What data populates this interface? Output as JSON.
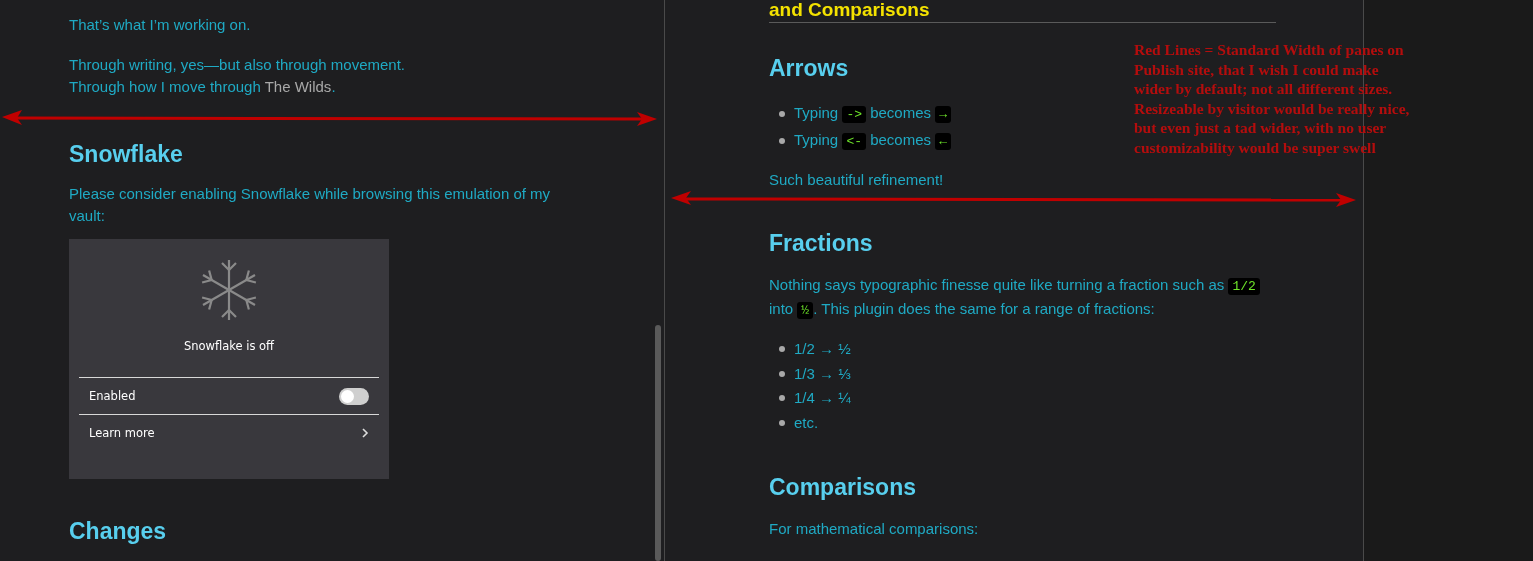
{
  "left_pane": {
    "paragraphs": [
      [
        {
          "kind": "text",
          "text": "That’s what I’m working on."
        }
      ],
      [
        {
          "kind": "text",
          "text": "Through writing, yes—but also through movement."
        },
        {
          "kind": "break"
        },
        {
          "kind": "text",
          "text": "Through how I move through "
        },
        {
          "kind": "link",
          "text": "The Wilds"
        },
        {
          "kind": "text",
          "text": "."
        }
      ]
    ],
    "section": {
      "heading": "Snowflake",
      "paragraph": [
        {
          "kind": "text",
          "text": "Please consider enabling Snowflake while browsing this emulation of my vault:"
        }
      ],
      "card": {
        "status": "Snowflake is off",
        "rows": [
          {
            "kind": "toggle",
            "label": "Enabled",
            "on": false
          },
          {
            "kind": "link",
            "label": "Learn more"
          }
        ]
      }
    },
    "next_heading": "Changes"
  },
  "right_pane": {
    "top_heading": "and Comparisons",
    "sections": [
      {
        "heading": "Arrows",
        "items": [
          [
            {
              "kind": "text",
              "text": "Typing "
            },
            {
              "kind": "code",
              "text": "->"
            },
            {
              "kind": "text",
              "text": " becomes "
            },
            {
              "kind": "code",
              "text": "→"
            }
          ],
          [
            {
              "kind": "text",
              "text": "Typing "
            },
            {
              "kind": "code",
              "text": "<-"
            },
            {
              "kind": "text",
              "text": " becomes "
            },
            {
              "kind": "code",
              "text": "←"
            }
          ]
        ],
        "after": [
          {
            "kind": "text",
            "text": "Such beautiful refinement!"
          }
        ]
      },
      {
        "heading": "Fractions",
        "before": [
          {
            "kind": "text",
            "text": "Nothing says typographic finesse quite like turning a fraction such as "
          },
          {
            "kind": "code",
            "text": "1/2"
          },
          {
            "kind": "text",
            "text": " into "
          },
          {
            "kind": "code",
            "text": "½"
          },
          {
            "kind": "text",
            "text": ". This plugin does the same for a range of fractions:"
          }
        ],
        "items": [
          [
            {
              "kind": "text",
              "text": "1/2 → ½"
            }
          ],
          [
            {
              "kind": "text",
              "text": "1/3 → ⅓"
            }
          ],
          [
            {
              "kind": "text",
              "text": "1/4 → ¼"
            }
          ],
          [
            {
              "kind": "text",
              "text": "etc."
            }
          ]
        ]
      },
      {
        "heading": "Comparisons",
        "before": [
          {
            "kind": "text",
            "text": "For mathematical comparisons:"
          }
        ]
      }
    ]
  },
  "annotation": {
    "text": "Red Lines = Standard Width of panes on\nPublish site, that I wish I could make\nwider by default; not all different sizes.\nResizeable by visitor would be really nice,\nbut even just a tad wider, with no user\ncustomizability would be super swell"
  }
}
